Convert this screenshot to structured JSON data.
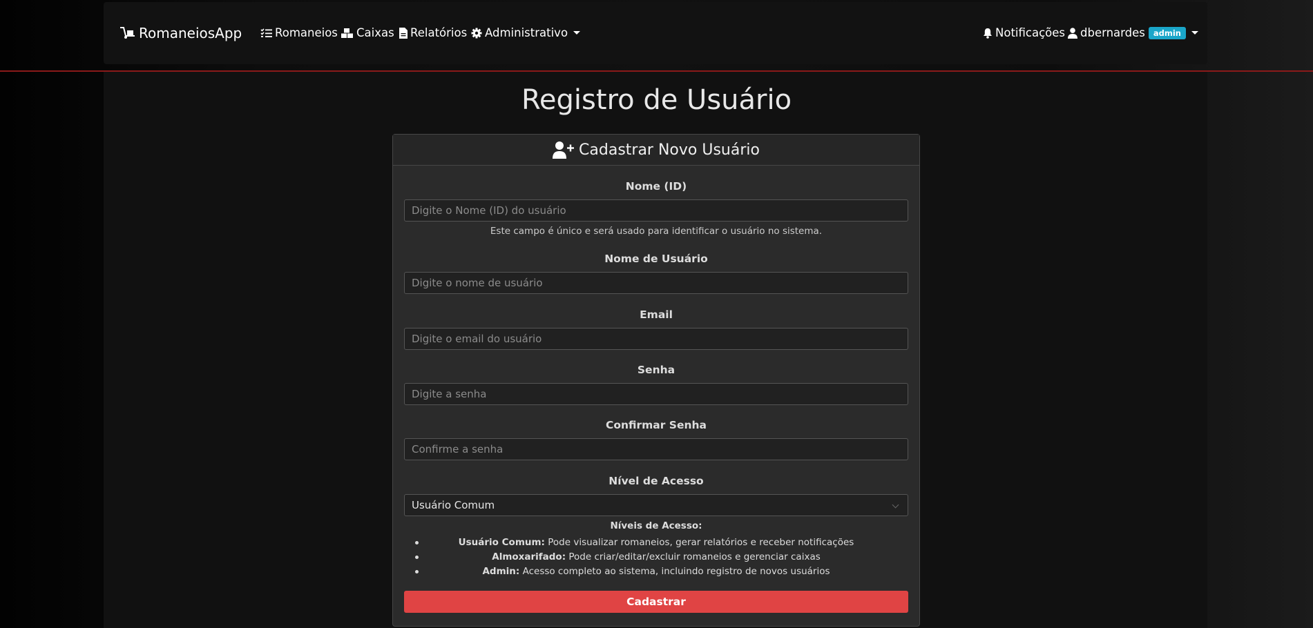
{
  "navbar": {
    "brand": "RomaneiosApp",
    "links": {
      "romaneios": "Romaneios",
      "caixas": "Caixas",
      "relatorios": "Relatórios",
      "administrativo": "Administrativo"
    },
    "notifications": "Notificações",
    "user": {
      "name": "dbernardes",
      "role_badge": "admin"
    }
  },
  "page": {
    "title": "Registro de Usuário"
  },
  "form": {
    "header": "Cadastrar Novo Usuário",
    "fields": {
      "id": {
        "label": "Nome (ID)",
        "placeholder": "Digite o Nome (ID) do usuário",
        "help": "Este campo é único e será usado para identificar o usuário no sistema."
      },
      "username": {
        "label": "Nome de Usuário",
        "placeholder": "Digite o nome de usuário"
      },
      "email": {
        "label": "Email",
        "placeholder": "Digite o email do usuário"
      },
      "password": {
        "label": "Senha",
        "placeholder": "Digite a senha"
      },
      "confirm": {
        "label": "Confirmar Senha",
        "placeholder": "Confirme a senha"
      },
      "access": {
        "label": "Nível de Acesso",
        "selected": "Usuário Comum"
      }
    },
    "levels": {
      "title": "Níveis de Acesso:",
      "items": [
        {
          "name": "Usuário Comum:",
          "desc": " Pode visualizar romaneios, gerar relatórios e receber notificações"
        },
        {
          "name": "Almoxarifado:",
          "desc": " Pode criar/editar/excluir romaneios e gerenciar caixas"
        },
        {
          "name": "Admin:",
          "desc": " Acesso completo ao sistema, incluindo registro de novos usuários"
        }
      ]
    },
    "submit": "Cadastrar"
  },
  "colors": {
    "accent": "#e04444",
    "badge": "#1aa6c9",
    "divider": "#8b1a1a"
  }
}
